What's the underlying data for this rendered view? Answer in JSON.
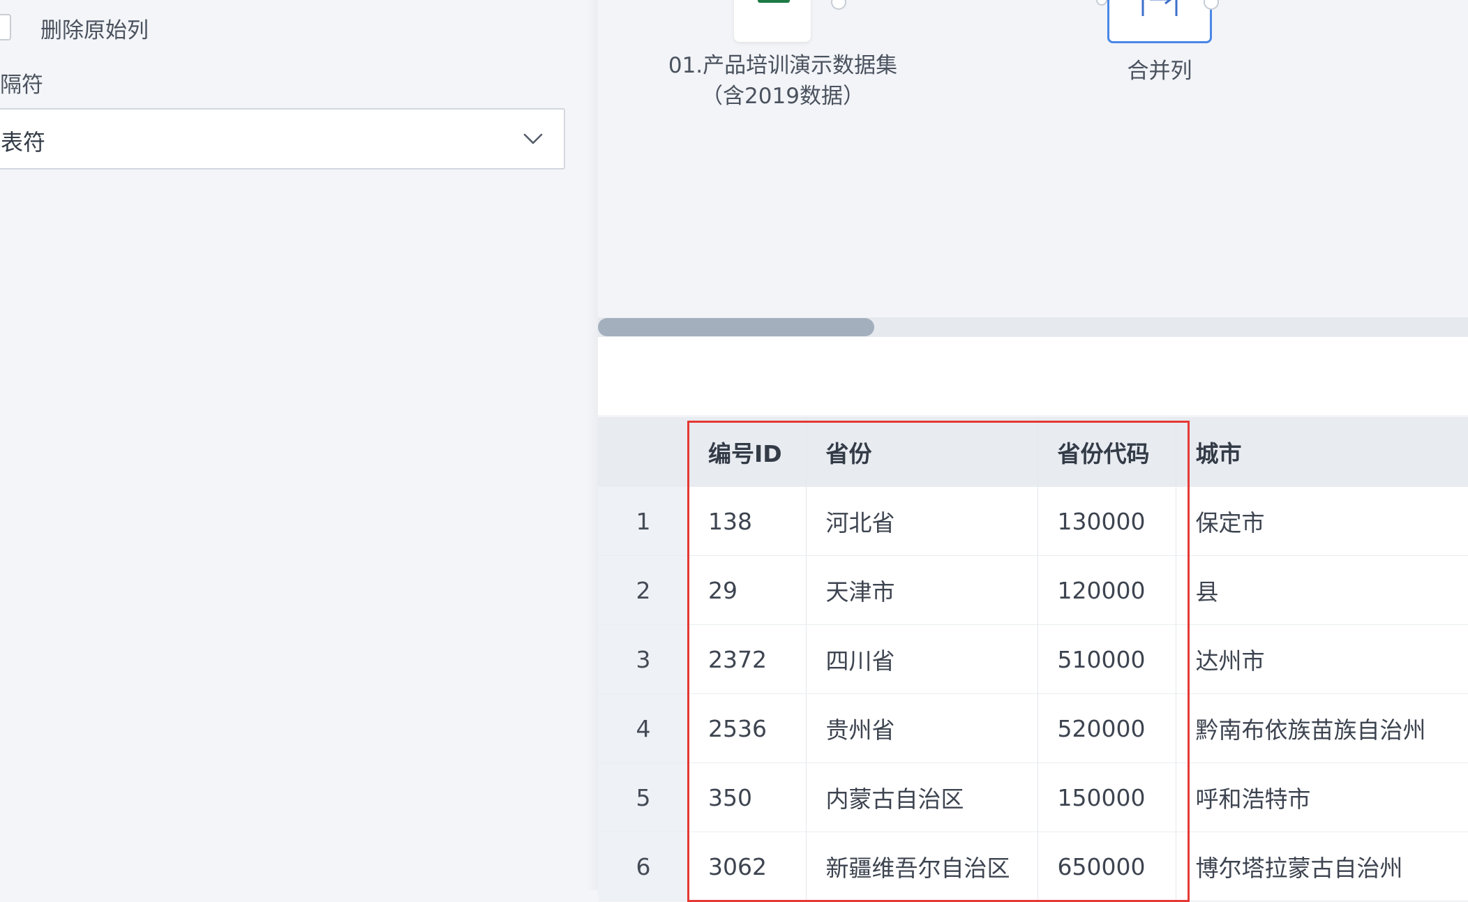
{
  "options": {
    "delete_original_label": "删除原始列",
    "separator_label": "分隔符",
    "separator_value": "制表符"
  },
  "canvas": {
    "source_node_label": "01.产品培训演示数据集（含2019数据）",
    "merge_node_label": "合并列"
  },
  "table": {
    "columns": [
      "编号ID",
      "省份",
      "省份代码",
      "城市"
    ],
    "rows": [
      {
        "n": "1",
        "id": "138",
        "province": "河北省",
        "code": "130000",
        "city": "保定市"
      },
      {
        "n": "2",
        "id": "29",
        "province": "天津市",
        "code": "120000",
        "city": "县"
      },
      {
        "n": "3",
        "id": "2372",
        "province": "四川省",
        "code": "510000",
        "city": "达州市"
      },
      {
        "n": "4",
        "id": "2536",
        "province": "贵州省",
        "code": "520000",
        "city": "黔南布依族苗族自治州"
      },
      {
        "n": "5",
        "id": "350",
        "province": "内蒙古自治区",
        "code": "150000",
        "city": "呼和浩特市"
      },
      {
        "n": "6",
        "id": "3062",
        "province": "新疆维吾尔自治区",
        "code": "650000",
        "city": "博尔塔拉蒙古自治州"
      }
    ]
  },
  "icons": {
    "source": "excel-file-icon",
    "merge": "merge-columns-icon",
    "select": "chevron-down-icon"
  },
  "colors": {
    "highlight": "#e53935",
    "accent": "#4a87e6",
    "excel": "#1e7a45"
  }
}
